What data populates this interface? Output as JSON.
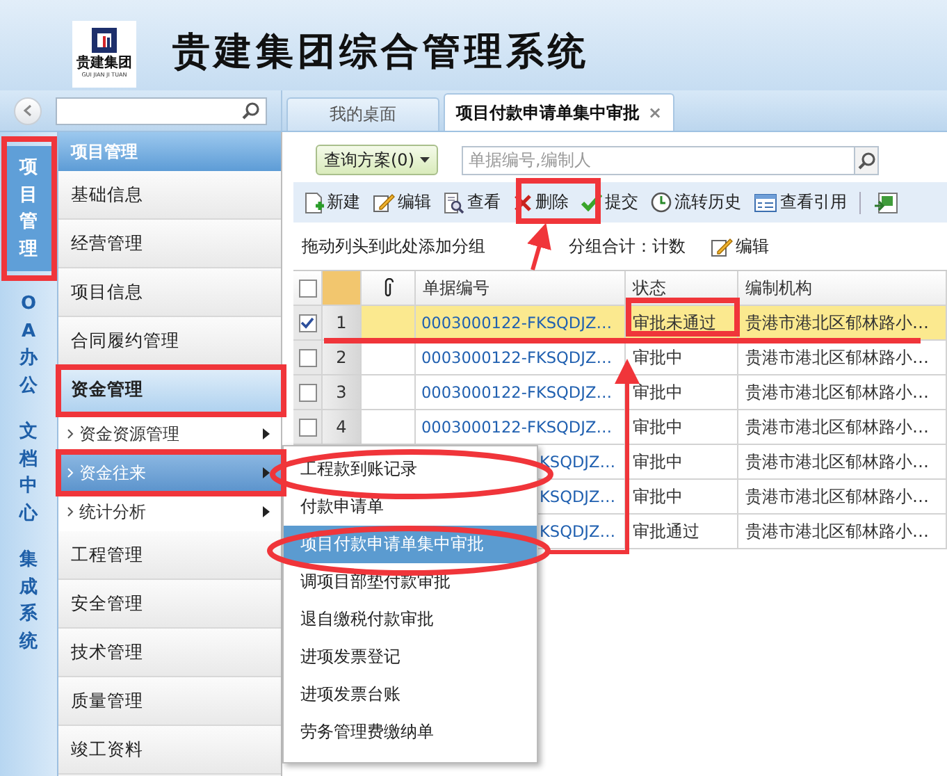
{
  "header": {
    "logo_text": "贵建集团",
    "logo_subtext": "GUI JIAN JI TUAN",
    "title": "贵建集团综合管理系统"
  },
  "tabs": [
    {
      "label": "我的桌面",
      "selected": false
    },
    {
      "label": "项目付款申请单集中审批",
      "selected": true,
      "close_label": "×"
    }
  ],
  "side_tabs": [
    {
      "label": "项目管理",
      "selected": true
    },
    {
      "label": "OA办公",
      "selected": false
    },
    {
      "label": "文档中心",
      "selected": false
    },
    {
      "label": "集成系统",
      "selected": false
    }
  ],
  "menu": {
    "title": "项目管理",
    "items": [
      {
        "label": "基础信息",
        "expanded": false
      },
      {
        "label": "经营管理",
        "expanded": false
      },
      {
        "label": "项目信息",
        "expanded": false
      },
      {
        "label": "合同履约管理",
        "expanded": false
      },
      {
        "label": "资金管理",
        "expanded": true,
        "children": [
          {
            "label": "资金资源管理",
            "selected": false
          },
          {
            "label": "资金往来",
            "selected": true
          },
          {
            "label": "统计分析",
            "selected": false
          }
        ]
      },
      {
        "label": "工程管理",
        "expanded": false
      },
      {
        "label": "安全管理",
        "expanded": false
      },
      {
        "label": "技术管理",
        "expanded": false
      },
      {
        "label": "质量管理",
        "expanded": false
      },
      {
        "label": "竣工资料",
        "expanded": false
      }
    ]
  },
  "flyout_menu": [
    {
      "label": "工程款到账记录",
      "selected": false
    },
    {
      "label": "付款申请单",
      "selected": false
    },
    {
      "label": "项目付款申请单集中审批",
      "selected": true
    },
    {
      "label": "调项目部垫付款审批",
      "selected": false
    },
    {
      "label": "退自缴税付款审批",
      "selected": false
    },
    {
      "label": "进项发票登记",
      "selected": false
    },
    {
      "label": "进项发票台账",
      "selected": false
    },
    {
      "label": "劳务管理费缴纳单",
      "selected": false
    }
  ],
  "query": {
    "scheme_button": "查询方案(0)",
    "search_placeholder": "单据编号,编制人"
  },
  "toolbar": [
    {
      "kind": "new",
      "label": "新建"
    },
    {
      "kind": "edit",
      "label": "编辑"
    },
    {
      "kind": "view",
      "label": "查看"
    },
    {
      "kind": "delete",
      "label": "删除"
    },
    {
      "kind": "submit",
      "label": "提交"
    },
    {
      "kind": "history",
      "label": "流转历史"
    },
    {
      "kind": "reference",
      "label": "查看引用"
    },
    {
      "kind": "export"
    }
  ],
  "group_bar": {
    "hint": "拖动列头到此处添加分组",
    "summary": "分组合计：计数",
    "edit": "编辑"
  },
  "table": {
    "header_checked": false,
    "columns": [
      "单据编号",
      "状态",
      "编制机构"
    ],
    "rows": [
      {
        "kind": "full",
        "checked": true,
        "selected": true,
        "number": "1",
        "doc_no": "0003000122-FKSQDJZ…",
        "status": "审批未通过",
        "org": "贵港市港北区郁林路小…"
      },
      {
        "kind": "full",
        "checked": false,
        "selected": false,
        "number": "2",
        "doc_no": "0003000122-FKSQDJZ…",
        "status": "审批中",
        "org": "贵港市港北区郁林路小…"
      },
      {
        "kind": "full",
        "checked": false,
        "selected": false,
        "number": "3",
        "doc_no": "0003000122-FKSQDJZ…",
        "status": "审批中",
        "org": "贵港市港北区郁林路小…"
      },
      {
        "kind": "full",
        "checked": false,
        "selected": false,
        "number": "4",
        "doc_no": "0003000122-FKSQDJZ…",
        "status": "审批中",
        "org": "贵港市港北区郁林路小…"
      },
      {
        "kind": "covered",
        "selected": false,
        "doc_no": "KSQDJZ…",
        "status": "审批中",
        "org": "贵港市港北区郁林路小…"
      },
      {
        "kind": "covered",
        "selected": false,
        "doc_no": "KSQDJZ…",
        "status": "审批中",
        "org": "贵港市港北区郁林路小…"
      },
      {
        "kind": "covered",
        "selected": false,
        "doc_no": "KSQDJZ…",
        "status": "审批通过",
        "org": "贵港市港北区郁林路小…"
      }
    ]
  }
}
